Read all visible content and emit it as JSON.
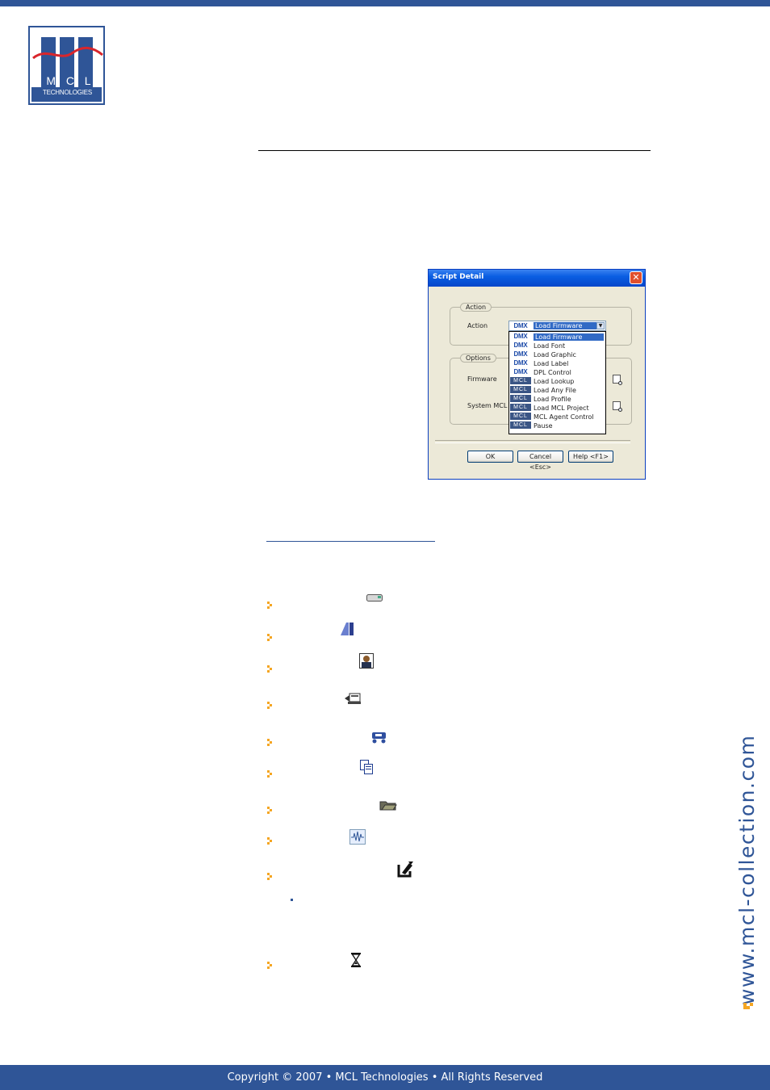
{
  "logo": {
    "letters": [
      "M",
      "C",
      "L"
    ],
    "subtitle": "TECHNOLOGIES",
    "brand_color": "#2f5597",
    "wave_color": "#d9262c"
  },
  "dialog": {
    "title": "Script Detail",
    "close_glyph": "✕",
    "action_group": "Action",
    "action_label": "Action",
    "selected_value": "Load Firmware",
    "options_group": "Options",
    "firmware_label": "Firmware",
    "system_mcl_label": "System MCL",
    "dropdown_items": [
      {
        "badge": "DMX",
        "label": "Load Firmware"
      },
      {
        "badge": "DMX",
        "label": "Load Font"
      },
      {
        "badge": "DMX",
        "label": "Load Graphic"
      },
      {
        "badge": "DMX",
        "label": "Load Label"
      },
      {
        "badge": "DMX",
        "label": "DPL Control"
      },
      {
        "badge": "MCL",
        "label": "Load Lookup"
      },
      {
        "badge": "MCL",
        "label": "Load Any File"
      },
      {
        "badge": "MCL",
        "label": "Load Profile"
      },
      {
        "badge": "MCL",
        "label": "Load MCL Project"
      },
      {
        "badge": "MCL",
        "label": "MCL Agent Control"
      },
      {
        "badge": "MCL",
        "label": "Pause"
      }
    ],
    "ok_button": "OK",
    "cancel_button": "Cancel <Esc>",
    "help_button": "Help <F1>"
  },
  "bullet_icons": [
    "load-firmware-icon",
    "load-font-icon",
    "load-graphic-icon",
    "load-label-icon",
    "dpl-control-icon",
    "load-lookup-icon",
    "load-any-file-icon",
    "load-profile-icon",
    "load-mcl-project-icon",
    "pause-icon"
  ],
  "side_url": "www.mcl-collection.com",
  "footer": "Copyright © 2007 • MCL Technologies • All Rights Reserved"
}
